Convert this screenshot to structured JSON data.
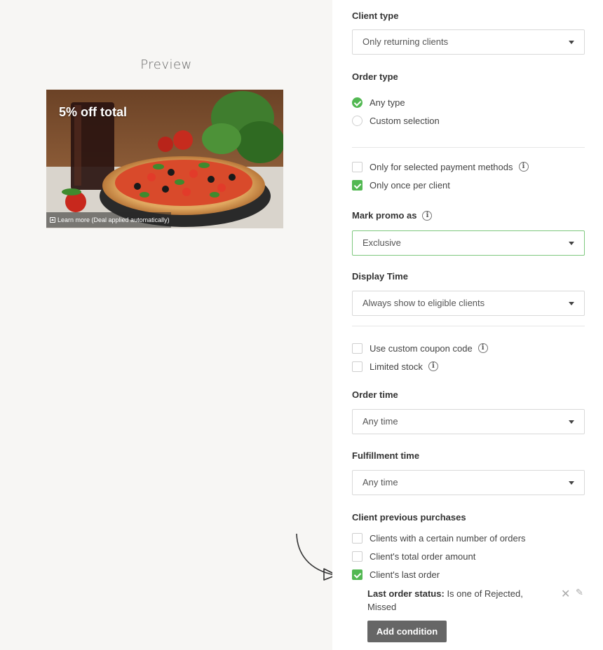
{
  "preview": {
    "title": "Preview",
    "promo_headline": "5% off total",
    "promo_footer": "Learn more (Deal applied automatically)"
  },
  "client_type": {
    "label": "Client type",
    "value": "Only returning clients"
  },
  "order_type": {
    "label": "Order type",
    "options": [
      {
        "label": "Any type",
        "selected": true
      },
      {
        "label": "Custom selection",
        "selected": false
      }
    ]
  },
  "restrictions": [
    {
      "label": "Only for selected payment methods",
      "checked": false
    },
    {
      "label": "Only once per client",
      "checked": true
    }
  ],
  "mark_promo": {
    "label": "Mark promo as",
    "value": "Exclusive"
  },
  "display_time": {
    "label": "Display Time",
    "value": "Always show to eligible clients"
  },
  "extras": [
    {
      "label": "Use custom coupon code",
      "checked": false
    },
    {
      "label": "Limited stock",
      "checked": false
    }
  ],
  "order_time": {
    "label": "Order time",
    "value": "Any time"
  },
  "fulfillment_time": {
    "label": "Fulfillment time",
    "value": "Any time"
  },
  "previous_purchases": {
    "label": "Client previous purchases",
    "options": [
      {
        "label": "Clients with a certain number of orders",
        "checked": false
      },
      {
        "label": "Client's total order amount",
        "checked": false
      },
      {
        "label": "Client's last order",
        "checked": true
      }
    ],
    "condition_label": "Last order status:",
    "condition_value": "Is one of  Rejected, Missed",
    "add_condition_label": "Add condition"
  },
  "info_glyph": "i",
  "colors": {
    "accent_green": "#52b852",
    "left_background": "#f7f6f4",
    "button_gray": "#666666"
  }
}
